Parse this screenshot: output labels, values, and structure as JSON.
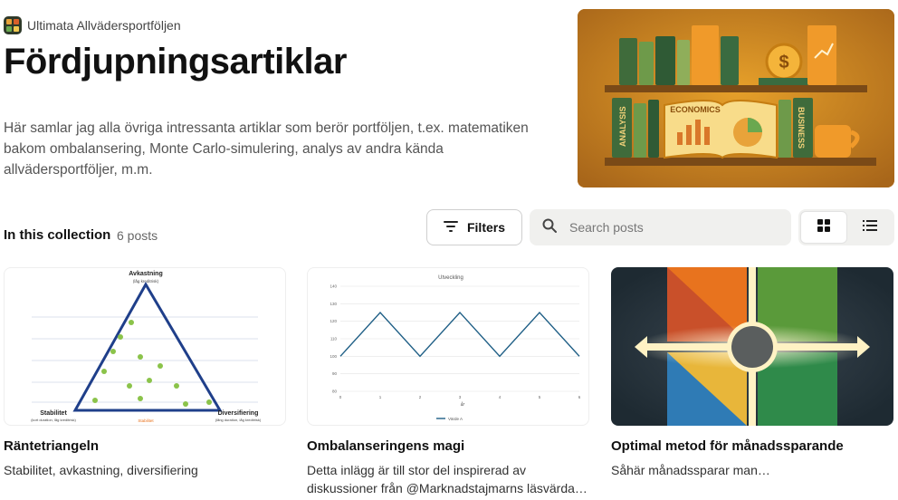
{
  "site": {
    "name": "Ultimata Allvädersportföljen"
  },
  "page": {
    "title": "Fördjupningsartiklar",
    "description": "Här samlar jag alla övriga intressanta artiklar som berör portföljen, t.ex. matematiken bakom ombalansering, Monte Carlo-simulering, analys av andra kända allvädersportföljer, m.m."
  },
  "hero": {
    "book_labels": [
      "ANALYSIS",
      "ECONOMICS",
      "BUSINESS"
    ]
  },
  "collection": {
    "label": "In this collection",
    "count": "6 posts"
  },
  "toolbar": {
    "filters_label": "Filters",
    "search_placeholder": "Search posts",
    "view_modes": [
      "grid",
      "list"
    ],
    "active_view": "grid"
  },
  "posts": [
    {
      "title": "Räntetriangeln",
      "excerpt": "Stabilitet, avkastning, diversifiering",
      "thumb": {
        "top": "Avkastning",
        "top_sub": "(låg kreditrisk)",
        "left": "Stabilitet",
        "left_sub": "(kort duration, låg kreditrisk)",
        "right": "Diversifiering",
        "right_sub": "(lång duration, låg kreditrisk)",
        "bottom_tag": "Stabilitet"
      }
    },
    {
      "title": "Ombalanseringens magi",
      "excerpt": "Detta inlägg är till stor del inspirerad av diskussioner från @Marknadstajmarns läsvärda…",
      "thumb": {
        "chart_data": {
          "type": "line",
          "title": "Utveckling",
          "x": [
            0,
            1,
            2,
            3,
            4,
            5,
            6
          ],
          "series": [
            {
              "name": "Värde A",
              "values": [
                100,
                125,
                100,
                125,
                100,
                125,
                100
              ]
            }
          ],
          "ylim": [
            80,
            140
          ],
          "yticks": [
            80,
            90,
            100,
            110,
            120,
            130,
            140
          ],
          "xlabel": "år",
          "ylabel": "",
          "grid": true,
          "legend": "bottom",
          "color": "#1f5f86"
        }
      }
    },
    {
      "title": "Optimal metod för månadssparande",
      "excerpt": "Såhär månadssparar man…",
      "thumb": {
        "colors": [
          "#e8731e",
          "#c9502a",
          "#5a9a3a",
          "#e8b63a",
          "#2f7bb5",
          "#2f8a4a"
        ]
      }
    }
  ]
}
